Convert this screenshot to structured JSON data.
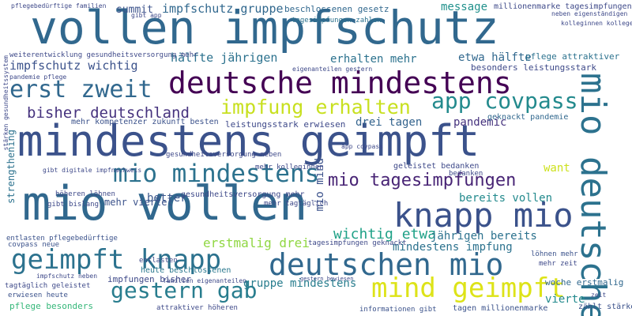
{
  "cloud": {
    "words": [
      {
        "text": "vollen impfschutz",
        "color": "#31688e"
      },
      {
        "text": "mindestens geimpft",
        "color": "#3b528b"
      },
      {
        "text": "mio vollen",
        "color": "#31688e"
      },
      {
        "text": "deutsche mindestens",
        "color": "#440154"
      },
      {
        "text": "knapp mio",
        "color": "#3b528b"
      },
      {
        "text": "geimpft knapp",
        "color": "#2c728e"
      },
      {
        "text": "deutschen mio",
        "color": "#31688e"
      },
      {
        "text": "mio mindestens",
        "color": "#2c728e"
      },
      {
        "text": "mio deutsche",
        "color": "#2c728e"
      },
      {
        "text": "mind geimpft",
        "color": "#dde318"
      },
      {
        "text": "impfung erhalten",
        "color": "#c8e020"
      },
      {
        "text": "app covpass",
        "color": "#238a8d"
      },
      {
        "text": "erst zweit",
        "color": "#31688e"
      },
      {
        "text": "bisher deutschland",
        "color": "#46337e"
      },
      {
        "text": "gestern gab",
        "color": "#287d8e"
      },
      {
        "text": "mio tagesimpfungen",
        "color": "#482475"
      },
      {
        "text": "wichtig etwa",
        "color": "#1fa187"
      },
      {
        "text": "erstmalig drei",
        "color": "#90d743"
      },
      {
        "text": "impfschutz gruppe",
        "color": "#31688e"
      },
      {
        "text": "hälfte jährigen",
        "color": "#2c728e"
      },
      {
        "text": "impfschutz wichtig",
        "color": "#3b528b"
      },
      {
        "text": "erhalten mehr",
        "color": "#2c728e"
      },
      {
        "text": "etwa hälfte",
        "color": "#31688e"
      },
      {
        "text": "message",
        "color": "#21918c"
      },
      {
        "text": "summit",
        "color": "#3b528b"
      },
      {
        "text": "drei tagen",
        "color": "#33638d"
      },
      {
        "text": "pandemic",
        "color": "#46337e"
      },
      {
        "text": "want",
        "color": "#cde11d"
      },
      {
        "text": "bereits vollen",
        "color": "#238a8d"
      },
      {
        "text": "jährigen bereits",
        "color": "#2c728e"
      },
      {
        "text": "mindestens impfung",
        "color": "#2c728e"
      },
      {
        "text": "gruppe mindestens",
        "color": "#287d8e"
      },
      {
        "text": "vierte",
        "color": "#238a8d"
      },
      {
        "text": "woche erstmalig",
        "color": "#31688e"
      },
      {
        "text": "impfungen bisher",
        "color": "#3e4989"
      },
      {
        "text": "heute beschlossenen",
        "color": "#2a788e"
      },
      {
        "text": "pflege besonders",
        "color": "#35b779"
      },
      {
        "text": "mehr viertel",
        "color": "#3b528b"
      },
      {
        "text": "better",
        "color": "#39568c"
      },
      {
        "text": "strengthening",
        "color": "#2c728e"
      },
      {
        "text": "mio mind",
        "color": "#3b528b"
      },
      {
        "text": "beschlossenen gesetz",
        "color": "#31688e"
      },
      {
        "text": "tagesimpfungen zahlen",
        "color": "#2c728e"
      },
      {
        "text": "millionenmarke tagesimpfungen",
        "color": "#3e4989"
      },
      {
        "text": "weiterentwicklung gesundheitsversorgung mehr",
        "color": "#3e4989"
      },
      {
        "text": "pflege attraktiver",
        "color": "#2c728e"
      },
      {
        "text": "besonders leistungsstark",
        "color": "#3e4989"
      },
      {
        "text": "mehr kompetenzer zukunft besten",
        "color": "#3b528b"
      },
      {
        "text": "leistungsstark erwiesen",
        "color": "#3e4989"
      },
      {
        "text": "geknackt pandemie",
        "color": "#31688e"
      },
      {
        "text": "geleistet bedanken",
        "color": "#3e4989"
      },
      {
        "text": "mehr kolleginnen",
        "color": "#3e4989"
      },
      {
        "text": "gesundheitsversorgung mehr",
        "color": "#3e4989"
      },
      {
        "text": "höheren löhnen",
        "color": "#3e4989"
      },
      {
        "text": "gibt bislang",
        "color": "#3e4989"
      },
      {
        "text": "mehr tagtäglich",
        "color": "#3e4989"
      },
      {
        "text": "entlasten pflegebedürftige",
        "color": "#3b528b"
      },
      {
        "text": "covpass neue",
        "color": "#3b528b"
      },
      {
        "text": "tagtäglich geleistet",
        "color": "#3e4989"
      },
      {
        "text": "erwiesen heute",
        "color": "#3b528b"
      },
      {
        "text": "impfschutz neben",
        "color": "#3e4989"
      },
      {
        "text": "attraktiver höheren",
        "color": "#3e4989"
      },
      {
        "text": "tagesimpfungen geknackt",
        "color": "#3e4989"
      },
      {
        "text": "gestern bewiesen",
        "color": "#3e4989"
      },
      {
        "text": "informationen gibt",
        "color": "#3b528b"
      },
      {
        "text": "tagen millionenmarke",
        "color": "#3b528b"
      },
      {
        "text": "zählt stärken",
        "color": "#3b528b"
      },
      {
        "text": "löhnen mehr",
        "color": "#3b528b"
      },
      {
        "text": "mehr zeit",
        "color": "#3e4989"
      },
      {
        "text": "familien eigenanteilen",
        "color": "#3e4989"
      },
      {
        "text": "gesundheitsversorgung neben",
        "color": "#3e4989"
      },
      {
        "text": "app covpass",
        "color": "#3e4989"
      },
      {
        "text": "pflegebedürftige familien",
        "color": "#3e4989"
      },
      {
        "text": "gibt app",
        "color": "#3e4989"
      },
      {
        "text": "neben eigenständigen",
        "color": "#3e4989"
      },
      {
        "text": "kolleginnen kollegen",
        "color": "#3e4989"
      },
      {
        "text": "pandemie pflege",
        "color": "#3e4989"
      },
      {
        "text": "entlasten",
        "color": "#3e4989"
      },
      {
        "text": "eigenanteilen gestern",
        "color": "#3e4989"
      },
      {
        "text": "gibt digitale impfnachweis",
        "color": "#3e4989"
      },
      {
        "text": "zeit",
        "color": "#3e4989"
      },
      {
        "text": "stärken gesundheitssystem",
        "color": "#3e4989"
      },
      {
        "text": "bedanken",
        "color": "#3e4989"
      }
    ]
  }
}
